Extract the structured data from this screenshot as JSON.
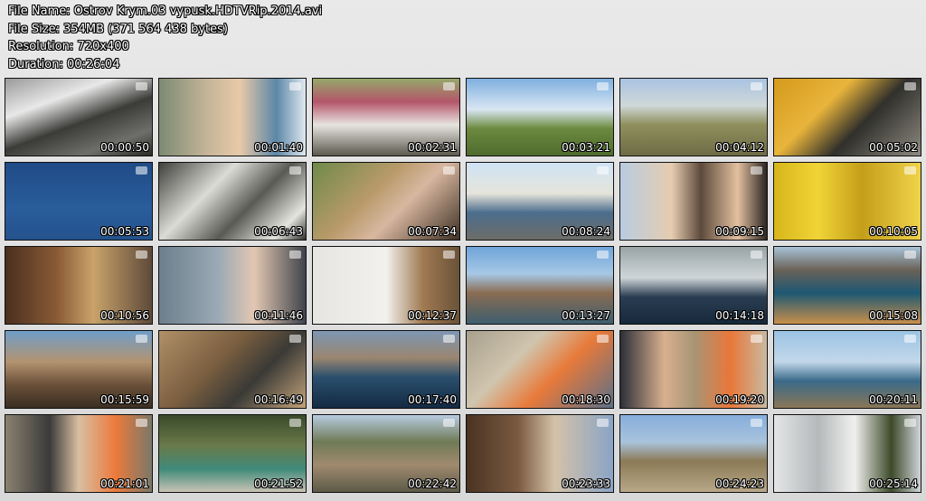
{
  "info": {
    "file_name": "File Name: Ostrov Krym.03 vypusk.HDTVRip.2014.avi",
    "file_size": "File Size: 354MB (371 564 438 bytes)",
    "resolution": "Resolution: 720x400",
    "duration": "Duration: 00:26:04"
  },
  "thumbnails": [
    {
      "time": "00:00:50",
      "bg": "linear-gradient(160deg,#9a9a9a 0%,#e8e8e8 30%,#3b3b38 55%,#6e6e6a 80%,#2a2a28 100%)"
    },
    {
      "time": "00:01:40",
      "bg": "linear-gradient(90deg,#7d8a74 0%,#c9b79b 35%,#e8c9a8 55%,#5b87a8 80%,#dfe8ef 100%)"
    },
    {
      "time": "00:02:31",
      "bg": "linear-gradient(180deg,#95a86a 0%,#b4556a 30%,#e6e4df 60%,#5c5a4e 100%)"
    },
    {
      "time": "00:03:21",
      "bg": "linear-gradient(180deg,#7fb0e0 0%,#d9e6f2 40%,#6c8a3e 65%,#4f6b2f 100%)"
    },
    {
      "time": "00:04:12",
      "bg": "linear-gradient(180deg,#a9c3e2 0%,#cfd8d8 35%,#8f8f5d 60%,#6e6b45 100%)"
    },
    {
      "time": "00:05:02",
      "bg": "linear-gradient(135deg,#d49a1c 0%,#e8b43b 35%,#30302c 60%,#8e8a80 100%)"
    },
    {
      "time": "00:05:53",
      "bg": "linear-gradient(180deg,#1f4b86 0%,#2a5d9c 60%,#24528c 100%)"
    },
    {
      "time": "00:06:43",
      "bg": "linear-gradient(135deg,#3f3f3c 0%,#dcdcd6 35%,#5a5a55 60%,#e5e5df 85%,#2f2f2d 100%)"
    },
    {
      "time": "00:07:34",
      "bg": "linear-gradient(135deg,#6f8a4a 0%,#b89a6a 40%,#d8b7a0 60%,#3f3124 100%)"
    },
    {
      "time": "00:08:24",
      "bg": "linear-gradient(180deg,#cfe3f5 0%,#e5e4da 40%,#4b6d8d 65%,#6d6d68 100%)"
    },
    {
      "time": "00:09:15",
      "bg": "linear-gradient(90deg,#b9cce0 0%,#e6ccb0 35%,#5d4a3c 55%,#e3c09f 80%,#2b2522 100%)"
    },
    {
      "time": "00:10:05",
      "bg": "linear-gradient(90deg,#d7b61a 0%,#f1d437 30%,#c49e1a 60%,#f0d34a 100%)"
    },
    {
      "time": "00:10:56",
      "bg": "linear-gradient(90deg,#4a2f1f 0%,#8a5a35 35%,#c9a36a 60%,#5e4a3a 100%)"
    },
    {
      "time": "00:11:46",
      "bg": "linear-gradient(90deg,#6d7e8c 0%,#9aa9b5 40%,#e2c7b2 65%,#3f434c 100%)"
    },
    {
      "time": "00:12:37",
      "bg": "linear-gradient(90deg,#e6e5e1 0%,#f2f1ee 50%,#a07a52 75%,#6a5238 100%)"
    },
    {
      "time": "00:13:27",
      "bg": "linear-gradient(180deg,#6fa4d8 0%,#a6c8e6 35%,#8a6c52 60%,#3d5e6e 100%)"
    },
    {
      "time": "00:14:18",
      "bg": "linear-gradient(180deg,#99a4a6 0%,#cfd6d8 40%,#2b3d52 65%,#16283a 100%)"
    },
    {
      "time": "00:15:08",
      "bg": "linear-gradient(180deg,#a8c3d8 0%,#6a6258 30%,#1d5873 60%,#c98f4a 100%)"
    },
    {
      "time": "00:15:59",
      "bg": "linear-gradient(180deg,#6f9ec8 0%,#b39370 40%,#6a5038 70%,#3a2e22 100%)"
    },
    {
      "time": "00:16:49",
      "bg": "linear-gradient(135deg,#b09068 0%,#7a5e40 40%,#3a3a36 65%,#c4a37a 100%)"
    },
    {
      "time": "00:17:40",
      "bg": "linear-gradient(180deg,#7d96b3 0%,#9a8670 35%,#2b4f6e 60%,#132a42 100%)"
    },
    {
      "time": "00:18:30",
      "bg": "linear-gradient(135deg,#a8a08e 0%,#d0c5ae 35%,#e87a3a 60%,#5b6f88 100%)"
    },
    {
      "time": "00:19:20",
      "bg": "linear-gradient(90deg,#2d2f38 0%,#d9b08f 30%,#a89575 50%,#e8773a 75%,#c9b9a0 100%)"
    },
    {
      "time": "00:20:11",
      "bg": "linear-gradient(180deg,#9cc3e3 0%,#c2d8ea 40%,#3a6a8a 65%,#8a7656 100%)"
    },
    {
      "time": "00:21:01",
      "bg": "linear-gradient(90deg,#8a8270 0%,#3a3a3a 30%,#d9bfa1 50%,#ec7a3c 75%,#7a7868 100%)"
    },
    {
      "time": "00:21:52",
      "bg": "linear-gradient(180deg,#3a4a2a 0%,#6a7a4a 40%,#3f8a7a 70%,#c9c3b4 100%)"
    },
    {
      "time": "00:22:42",
      "bg": "linear-gradient(180deg,#b7cbe0 0%,#6f7a56 35%,#a08a6e 65%,#5c5a48 100%)"
    },
    {
      "time": "00:23:33",
      "bg": "linear-gradient(90deg,#4a3322 0%,#7a5a40 35%,#d4c2a8 60%,#8aa4c6 100%)"
    },
    {
      "time": "00:24:23",
      "bg": "linear-gradient(180deg,#86aedc 0%,#a9c3dc 35%,#8c7a56 60%,#b8a888 100%)"
    },
    {
      "time": "00:25:14",
      "bg": "linear-gradient(90deg,#e3e5e6 0%,#b5b9bb 30%,#f0f0ee 55%,#3c4a2a 80%,#cfd4d8 100%)"
    }
  ]
}
